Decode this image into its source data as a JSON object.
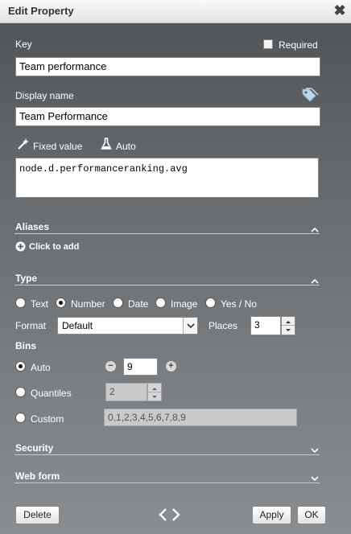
{
  "dialog": {
    "title": "Edit Property",
    "close_glyph": "✖"
  },
  "key": {
    "label": "Key",
    "value": "Team performance"
  },
  "required": {
    "label": "Required",
    "checked": false
  },
  "display_name": {
    "label": "Display name",
    "value": "Team Performance",
    "icon": "tags-icon"
  },
  "value_mode": {
    "fixed_label": "Fixed value",
    "auto_label": "Auto"
  },
  "expression": {
    "value": "node.d.performanceranking.avg"
  },
  "aliases": {
    "header": "Aliases",
    "add_label": "Click to add",
    "expanded": true
  },
  "type": {
    "header": "Type",
    "expanded": true,
    "options": [
      "Text",
      "Number",
      "Date",
      "Image",
      "Yes / No"
    ],
    "selected": "Number"
  },
  "format": {
    "label": "Format",
    "value": "Default"
  },
  "places": {
    "label": "Places",
    "value": "3"
  },
  "bins": {
    "label": "Bins",
    "selected": "Auto",
    "auto": {
      "label": "Auto",
      "value": "9"
    },
    "quantiles": {
      "label": "Quantiles",
      "value": "2"
    },
    "custom": {
      "label": "Custom",
      "value": "0,1,2,3,4,5,6,7,8,9"
    }
  },
  "security": {
    "header": "Security",
    "expanded": false
  },
  "web_form": {
    "header": "Web form",
    "expanded": false
  },
  "footer": {
    "delete_label": "Delete",
    "apply_label": "Apply",
    "ok_label": "OK"
  }
}
